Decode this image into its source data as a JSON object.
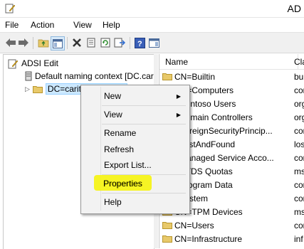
{
  "window": {
    "title": "AD"
  },
  "menubar": [
    "File",
    "Action",
    "View",
    "Help"
  ],
  "toolbar_icons": [
    "back-arrow-icon",
    "forward-arrow-icon",
    "up-folder-icon",
    "show-hide-console-tree-icon",
    "delete-icon",
    "properties-sheet-icon",
    "refresh-icon",
    "export-list-icon",
    "help-icon",
    "show-action-pane-icon"
  ],
  "tree": {
    "root": "ADSI Edit",
    "context": "Default naming context [DC.car",
    "domain": "DC=carit... DC=local"
  },
  "columns": {
    "name": "Name",
    "class": "Cla"
  },
  "rows": [
    {
      "name": "CN=Builtin",
      "cls": "bui"
    },
    {
      "name": "CN=Computers",
      "cls": "con"
    },
    {
      "name": "=Contoso Users",
      "cls": "org"
    },
    {
      "name": "=Domain Controllers",
      "cls": "org"
    },
    {
      "name": "=ForeignSecurityPrincip...",
      "cls": "con"
    },
    {
      "name": "=LostAndFound",
      "cls": "los"
    },
    {
      "name": "=Managed Service Acco...",
      "cls": "con"
    },
    {
      "name": "=NTDS Quotas",
      "cls": "ms"
    },
    {
      "name": "=Program Data",
      "cls": "con"
    },
    {
      "name": "=System",
      "cls": "con"
    },
    {
      "name": "CN=TPM Devices",
      "cls": "ms"
    },
    {
      "name": "CN=Users",
      "cls": "con"
    },
    {
      "name": "CN=Infrastructure",
      "cls": "inf"
    }
  ],
  "context_menu": {
    "new": "New",
    "view": "View",
    "rename": "Rename",
    "refresh": "Refresh",
    "export": "Export List...",
    "properties": "Properties",
    "help": "Help"
  },
  "colors": {
    "highlight": "#f7f500",
    "selection": "#cce8ff",
    "folder": "#e8c96a"
  }
}
